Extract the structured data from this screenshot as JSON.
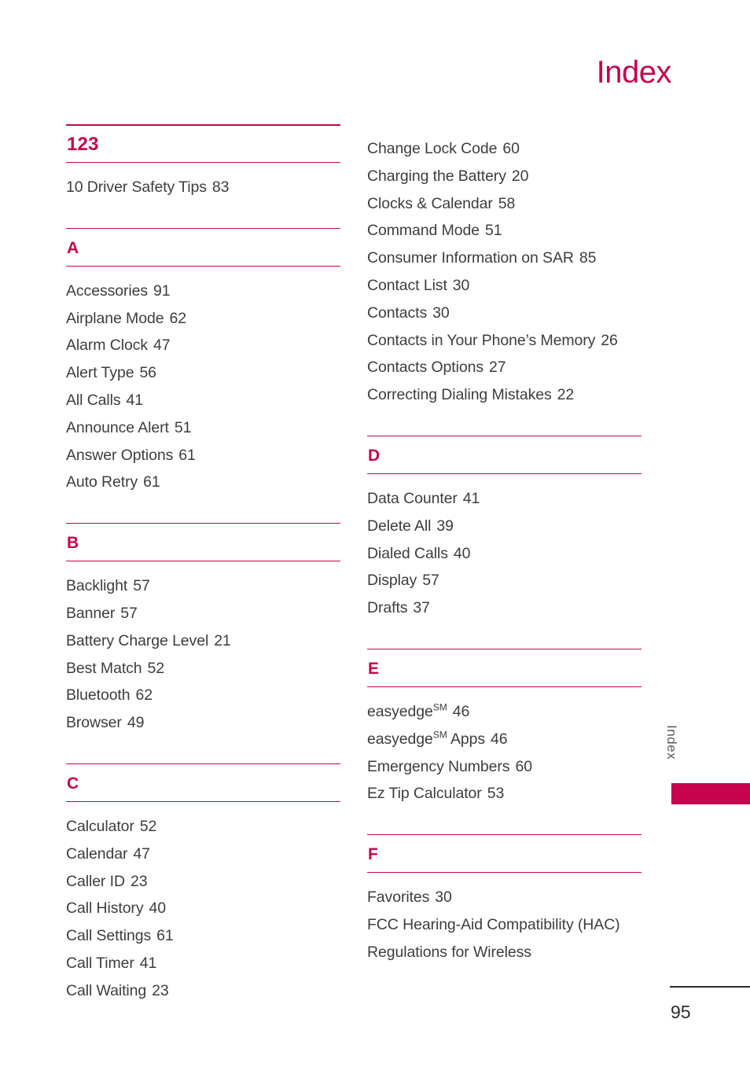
{
  "page": {
    "title": "Index",
    "side_tab_label": "Index",
    "page_number": "95",
    "accent_color": "#c6054e",
    "text_color": "#3d3d3d",
    "footer_rule_color": "#2c2c2c"
  },
  "columns": [
    {
      "name": "left-column",
      "sections": [
        {
          "letter": "123",
          "numeric": true,
          "entries": [
            {
              "title": "10 Driver Safety Tips",
              "page": "83"
            }
          ]
        },
        {
          "letter": "A",
          "numeric": false,
          "entries": [
            {
              "title": "Accessories",
              "page": "91"
            },
            {
              "title": "Airplane Mode",
              "page": "62"
            },
            {
              "title": "Alarm Clock",
              "page": "47"
            },
            {
              "title": "Alert Type",
              "page": "56"
            },
            {
              "title": "All Calls",
              "page": "41"
            },
            {
              "title": "Announce Alert",
              "page": "51"
            },
            {
              "title": "Answer Options",
              "page": "61"
            },
            {
              "title": "Auto Retry",
              "page": "61"
            }
          ]
        },
        {
          "letter": "B",
          "numeric": false,
          "entries": [
            {
              "title": "Backlight",
              "page": "57"
            },
            {
              "title": "Banner",
              "page": "57"
            },
            {
              "title": "Battery Charge Level",
              "page": "21"
            },
            {
              "title": "Best Match",
              "page": "52"
            },
            {
              "title": "Bluetooth",
              "page": "62"
            },
            {
              "title": "Browser",
              "page": "49"
            }
          ]
        },
        {
          "letter": "C",
          "numeric": false,
          "entries": [
            {
              "title": "Calculator",
              "page": "52"
            },
            {
              "title": "Calendar",
              "page": "47"
            },
            {
              "title": "Caller ID",
              "page": "23"
            },
            {
              "title": "Call History",
              "page": "40"
            },
            {
              "title": "Call Settings",
              "page": "61"
            },
            {
              "title": "Call Timer",
              "page": "41"
            },
            {
              "title": "Call Waiting",
              "page": "23"
            }
          ]
        }
      ]
    },
    {
      "name": "right-column",
      "sections": [
        {
          "letter": "",
          "numeric": false,
          "no_header": true,
          "entries": [
            {
              "title": "Change Lock Code",
              "page": "60"
            },
            {
              "title": "Charging the Battery",
              "page": "20"
            },
            {
              "title": "Clocks & Calendar",
              "page": "58"
            },
            {
              "title": "Command Mode",
              "page": "51"
            },
            {
              "title": "Consumer Information on SAR",
              "page": "85"
            },
            {
              "title": "Contact List",
              "page": "30"
            },
            {
              "title": "Contacts",
              "page": "30"
            },
            {
              "title": "Contacts in Your Phone’s Memory",
              "page": "26",
              "wrap": true
            },
            {
              "title": "Contacts Options",
              "page": "27"
            },
            {
              "title": "Correcting Dialing Mistakes",
              "page": "22"
            }
          ]
        },
        {
          "letter": "D",
          "numeric": false,
          "entries": [
            {
              "title": "Data Counter",
              "page": "41"
            },
            {
              "title": "Delete All",
              "page": "39"
            },
            {
              "title": "Dialed Calls",
              "page": "40"
            },
            {
              "title": "Display",
              "page": "57"
            },
            {
              "title": "Drafts",
              "page": "37"
            }
          ]
        },
        {
          "letter": "E",
          "numeric": false,
          "entries": [
            {
              "title": "easyedge",
              "sup": "SM",
              "page": "46"
            },
            {
              "title": "easyedge",
              "sup": "SM",
              "title_after": " Apps",
              "page": "46"
            },
            {
              "title": "Emergency Numbers",
              "page": "60"
            },
            {
              "title": "Ez Tip Calculator",
              "page": "53"
            }
          ]
        },
        {
          "letter": "F",
          "numeric": false,
          "entries": [
            {
              "title": "Favorites",
              "page": "30"
            },
            {
              "title": "FCC Hearing-Aid Compatibility (HAC) Regulations for Wireless",
              "page": "",
              "wrap": true
            }
          ]
        }
      ]
    }
  ]
}
